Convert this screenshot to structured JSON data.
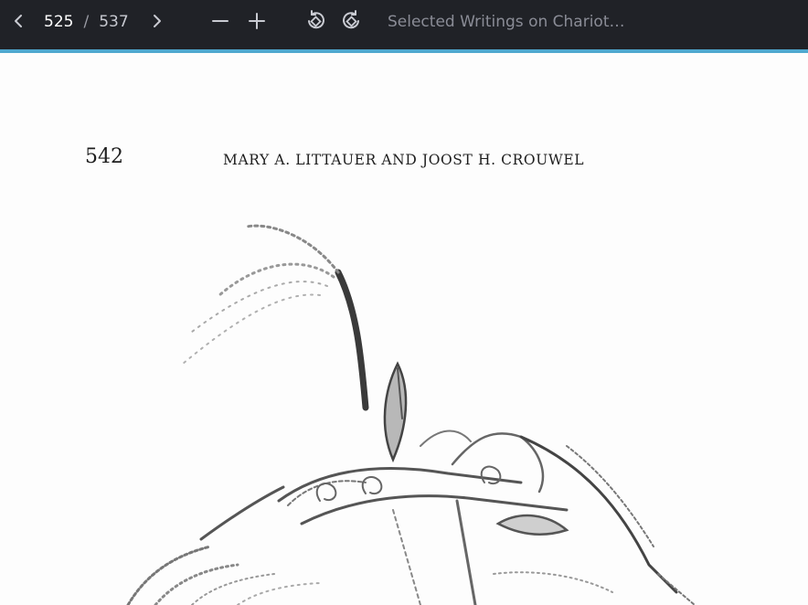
{
  "toolbar": {
    "prev_icon": "chevron-left-icon",
    "next_icon": "chevron-right-icon",
    "current_page": "525",
    "separator": "/",
    "total_pages": "537",
    "zoom_out_icon": "minus-icon",
    "zoom_in_icon": "plus-icon",
    "rotate_ccw_icon": "rotate-left-icon",
    "rotate_cw_icon": "rotate-right-icon",
    "document_title": "Selected Writings on Chariot…",
    "accent_color": "#4fa8cf",
    "background_color": "#202227"
  },
  "page": {
    "page_number": "542",
    "running_head": "MARY A. LITTAUER AND JOOST H. CROUWEL"
  }
}
